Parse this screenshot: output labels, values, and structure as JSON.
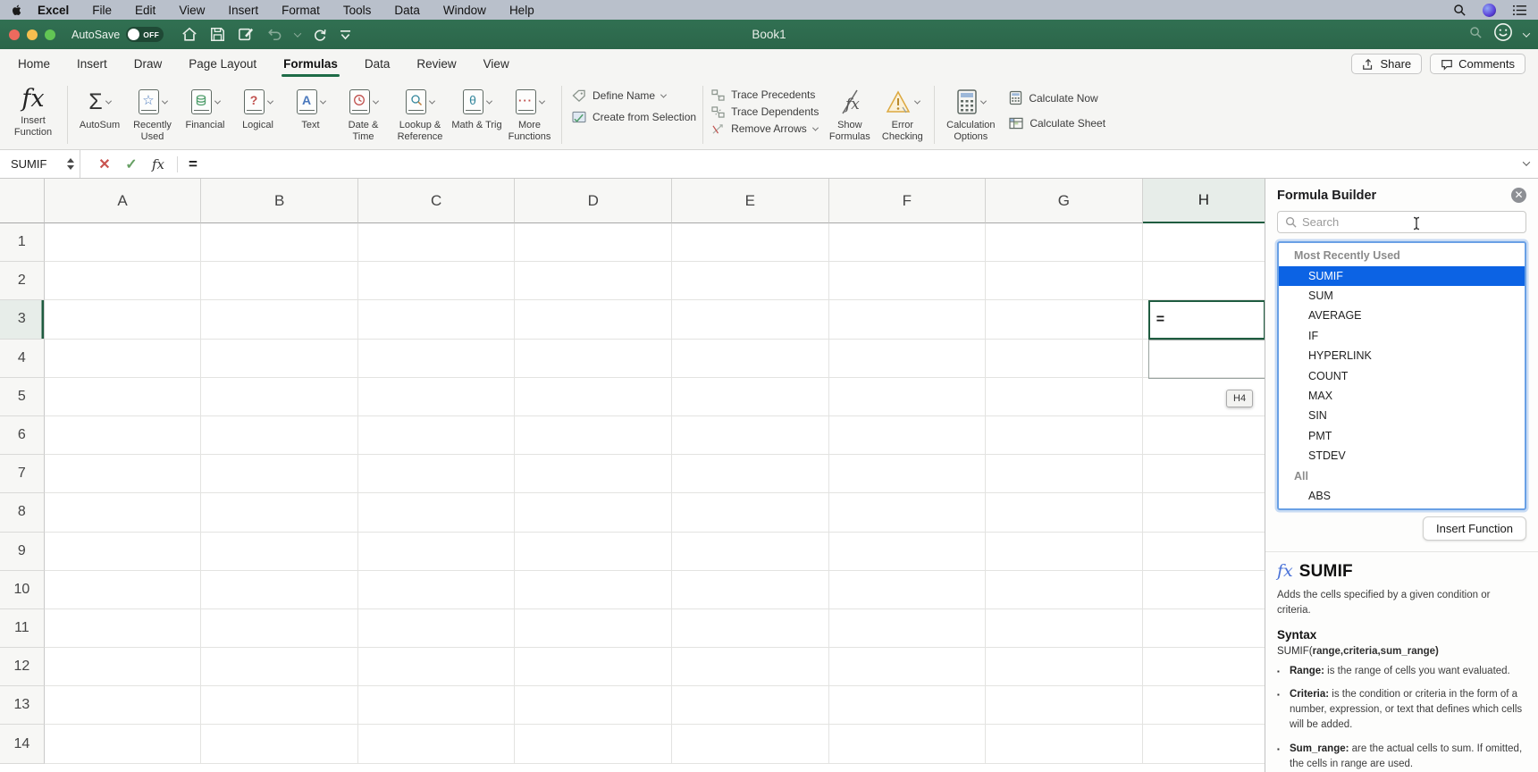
{
  "colors": {
    "excel_green": "#2e6b4e",
    "tab_accent": "#1e6b47",
    "selection_blue": "#0c63e4",
    "active_cell_border": "#1f5c40"
  },
  "menubar": {
    "items": [
      {
        "label": "Excel",
        "bold": true
      },
      {
        "label": "File"
      },
      {
        "label": "Edit"
      },
      {
        "label": "View"
      },
      {
        "label": "Insert"
      },
      {
        "label": "Format"
      },
      {
        "label": "Tools"
      },
      {
        "label": "Data"
      },
      {
        "label": "Window"
      },
      {
        "label": "Help"
      }
    ]
  },
  "titlebar": {
    "autosave_label": "AutoSave",
    "autosave_state": "OFF",
    "title": "Book1"
  },
  "tab_row": {
    "tabs": [
      {
        "label": "Home"
      },
      {
        "label": "Insert"
      },
      {
        "label": "Draw"
      },
      {
        "label": "Page Layout"
      },
      {
        "label": "Formulas",
        "active": true
      },
      {
        "label": "Data"
      },
      {
        "label": "Review"
      },
      {
        "label": "View"
      }
    ],
    "share_label": "Share",
    "comments_label": "Comments"
  },
  "ribbon": {
    "insert_function": "Insert Function",
    "autosum": "AutoSum",
    "recently_used": "Recently Used",
    "financial": "Financial",
    "logical": "Logical",
    "text": "Text",
    "date_time": "Date & Time",
    "lookup_ref": "Lookup & Reference",
    "math_trig": "Math & Trig",
    "more_functions": "More Functions",
    "define_name": "Define Name",
    "create_from_selection": "Create from Selection",
    "trace_precedents": "Trace Precedents",
    "trace_dependents": "Trace Dependents",
    "remove_arrows": "Remove Arrows",
    "show_formulas": "Show Formulas",
    "error_checking": "Error Checking",
    "calculation_options": "Calculation Options",
    "calculate_now": "Calculate Now",
    "calculate_sheet": "Calculate Sheet"
  },
  "formula_bar": {
    "name_box_value": "SUMIF",
    "formula_value": "="
  },
  "grid": {
    "columns": [
      "A",
      "B",
      "C",
      "D",
      "E",
      "F",
      "G",
      "H"
    ],
    "rows": [
      1,
      2,
      3,
      4,
      5,
      6,
      7,
      8,
      9,
      10,
      11,
      12,
      13,
      14
    ],
    "selected_column": "H",
    "selected_row": 3,
    "active_cell": {
      "column": "H",
      "row": 3,
      "value": "="
    },
    "tooltip": "H4"
  },
  "panel": {
    "title": "Formula Builder",
    "search_placeholder": "Search",
    "list": {
      "items": [
        {
          "label": "Most Recently Used",
          "type": "header"
        },
        {
          "label": "SUMIF",
          "type": "item",
          "selected": true
        },
        {
          "label": "SUM",
          "type": "item"
        },
        {
          "label": "AVERAGE",
          "type": "item"
        },
        {
          "label": "IF",
          "type": "item"
        },
        {
          "label": "HYPERLINK",
          "type": "item"
        },
        {
          "label": "COUNT",
          "type": "item"
        },
        {
          "label": "MAX",
          "type": "item"
        },
        {
          "label": "SIN",
          "type": "item"
        },
        {
          "label": "PMT",
          "type": "item"
        },
        {
          "label": "STDEV",
          "type": "item"
        },
        {
          "label": "All",
          "type": "header"
        },
        {
          "label": "ABS",
          "type": "item"
        }
      ]
    },
    "insert_button_label": "Insert Function",
    "details": {
      "fx": "fx",
      "function_name": "SUMIF",
      "description": "Adds the cells specified by a given condition or criteria.",
      "syntax_heading": "Syntax",
      "syntax_prefix": "SUMIF(",
      "syntax_args": "range,criteria,sum_range)",
      "params": [
        {
          "name": "Range:",
          "text": " is the range of cells you want evaluated."
        },
        {
          "name": "Criteria:",
          "text": " is the condition or criteria in the form of a number, expression, or text that defines which cells will be added."
        },
        {
          "name": "Sum_range:",
          "text": " are the actual cells to sum. If omitted, the cells in range are used."
        }
      ]
    }
  }
}
